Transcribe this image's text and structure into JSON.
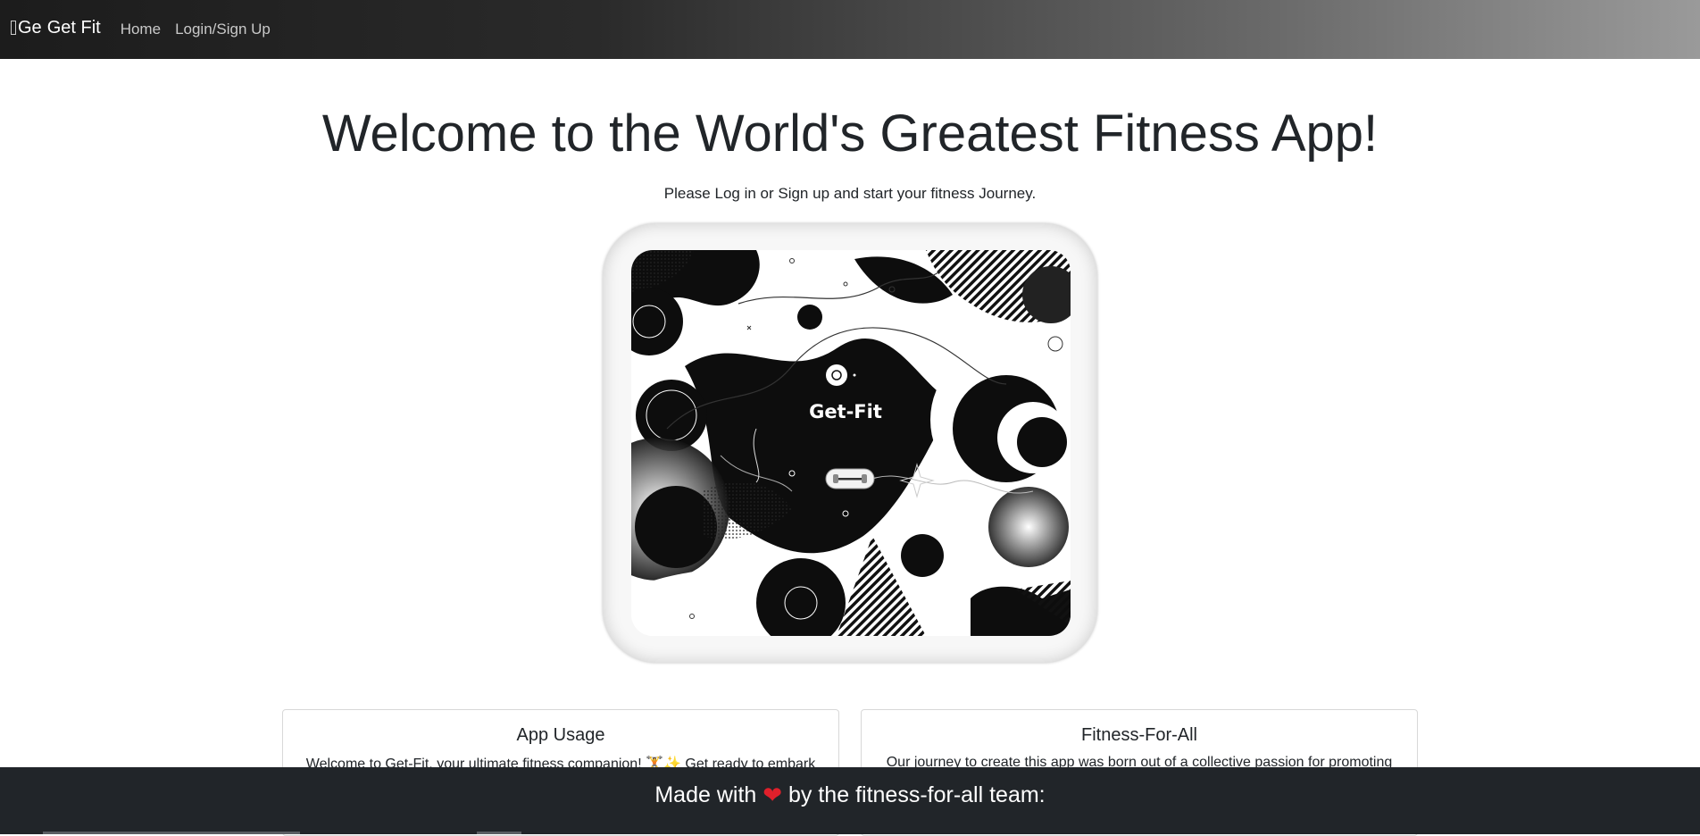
{
  "navbar": {
    "logo_alt": "Ge",
    "brand": "Get Fit",
    "links": [
      "Home",
      "Login/Sign Up"
    ]
  },
  "hero": {
    "title": "Welcome to the World's Greatest Fitness App!",
    "subtitle": "Please Log in or Sign up and start your fitness Journey."
  },
  "artwork": {
    "label": "Get-Fit"
  },
  "cards": [
    {
      "title": "App Usage",
      "text": "Welcome to Get-Fit, your ultimate fitness companion! 🏋️✨ Get ready to embark"
    },
    {
      "title": "Fitness-For-All",
      "text": "Our journey to create this app was born out of a collective passion for promoting"
    }
  ],
  "footer": {
    "text_before": "Made with",
    "text_after": "by the fitness-for-all team:",
    "heart_color": "#e0202b"
  }
}
